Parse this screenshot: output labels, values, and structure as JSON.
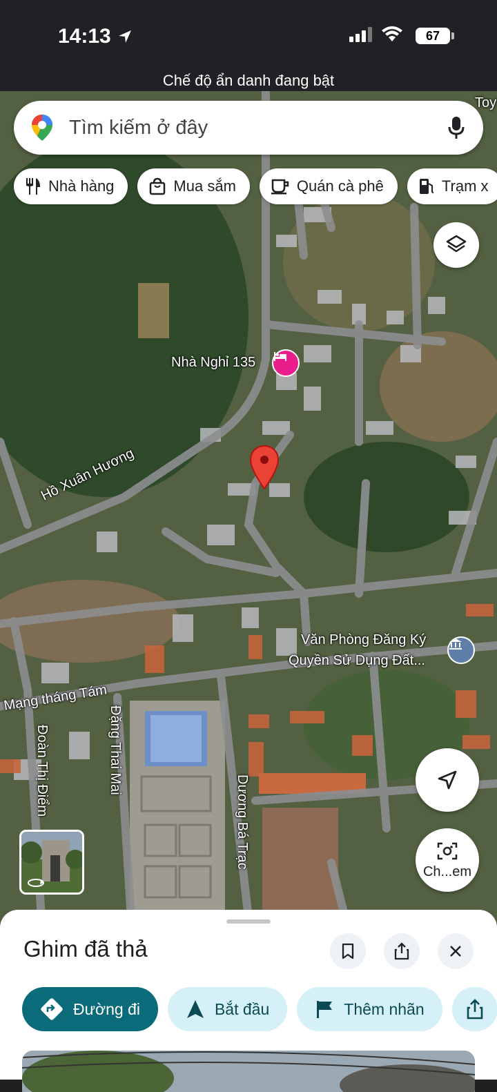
{
  "status_bar": {
    "time": "14:13",
    "battery": "67",
    "incognito": "Chế độ ẩn danh đang bật"
  },
  "search": {
    "placeholder": "Tìm kiếm ở đây"
  },
  "chips": [
    {
      "label": "Nhà hàng",
      "icon": "fork-knife-icon"
    },
    {
      "label": "Mua sắm",
      "icon": "shopping-bag-icon"
    },
    {
      "label": "Quán cà phê",
      "icon": "coffee-cup-icon"
    },
    {
      "label": "Trạm x",
      "icon": "gas-station-icon"
    }
  ],
  "map": {
    "labels": {
      "toy": "Toy",
      "guest_house": "Nhà Nghỉ 135",
      "ho_xuan_huong": "Hồ Xuân Hương",
      "office_line1": "Văn Phòng Đăng Ký",
      "office_line2": "Quyền Sử Dụng Đất...",
      "cach_mang": "Mạng tháng Tám",
      "doan_thi_diem": "Đoàn Thị Điểm",
      "dang_thai_mai": "Đặng Thai Mai",
      "duong_ba_trac": "Dương Bá Trạc"
    },
    "lens_label": "Ch...em"
  },
  "sheet": {
    "title": "Ghim đã thả",
    "actions": {
      "directions": "Đường đi",
      "start": "Bắt đầu",
      "add_label": "Thêm nhãn"
    }
  },
  "colors": {
    "accent": "#0b6b7a",
    "pin": "#ea4335",
    "hotel": "#e91e8c"
  }
}
